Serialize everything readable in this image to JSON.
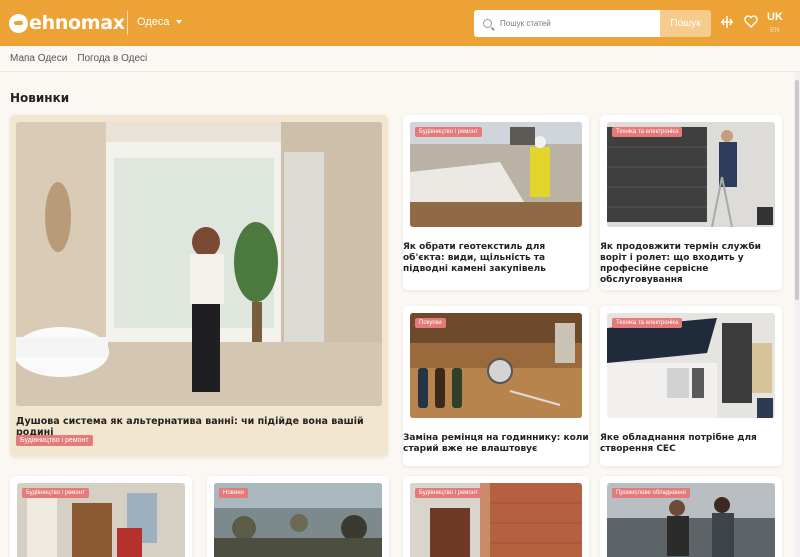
{
  "header": {
    "logo_text": "ehnomax",
    "city": "Одеса",
    "search_placeholder": "Пошук статей",
    "search_button": "Пошук",
    "lang": "UK",
    "lang_sub": "EN",
    "brand_color": "#eda236"
  },
  "breadcrumbs": [
    "Мапа Одеси",
    "Погода в Одесі"
  ],
  "section_title": "Новинки",
  "cards": [
    {
      "tag": "Будівництво і ремонт",
      "title": "Душова система як альтернатива ванні: чи підійде вона вашій родині",
      "badge": "Будівництво і ремонт"
    },
    {
      "tag": "Будівництво і ремонт",
      "title": "Як обрати геотекстиль для об'єкта: види, щільність та підводні камені закупівель"
    },
    {
      "tag": "Техніка та електроніка",
      "title": "Як продовжити термін служби воріт і ролет: що входить у професійне сервісне обслуговування"
    },
    {
      "tag": "Покупки",
      "title": "Заміна ремінця на годиннику: коли старий вже не влаштовує"
    },
    {
      "tag": "Техніка та електроніка",
      "title": "Яке обладнання потрібне для створення СЕС"
    },
    {
      "tag": "Будівництво і ремонт",
      "title": ""
    },
    {
      "tag": "Новини",
      "title": ""
    },
    {
      "tag": "Будівництво і ремонт",
      "title": ""
    },
    {
      "tag": "Промислове обладнання",
      "title": ""
    }
  ],
  "colors": {
    "accent": "#eda236",
    "tag": "#e47a7a"
  },
  "icons": [
    "search-icon",
    "compare-icon",
    "heart-icon",
    "chevron-down-icon"
  ]
}
